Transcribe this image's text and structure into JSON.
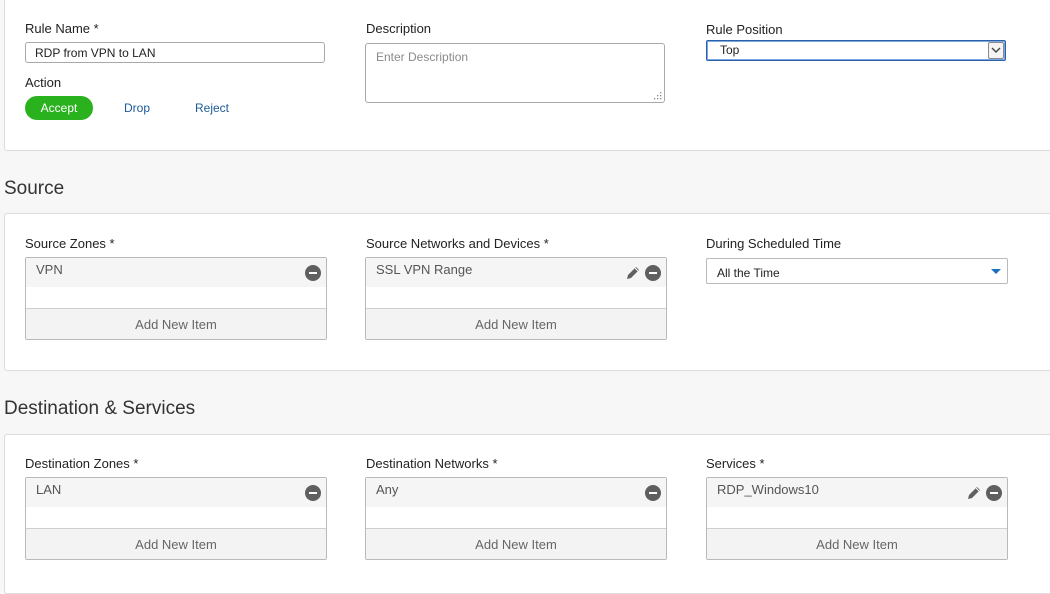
{
  "rule": {
    "name_label": "Rule Name *",
    "name_value": "RDP from VPN to LAN",
    "description_label": "Description",
    "description_placeholder": "Enter Description",
    "position_label": "Rule Position",
    "position_value": "Top",
    "action_label": "Action",
    "actions": [
      {
        "label": "Accept",
        "selected": true
      },
      {
        "label": "Drop",
        "selected": false
      },
      {
        "label": "Reject",
        "selected": false
      }
    ]
  },
  "source": {
    "title": "Source",
    "zones_label": "Source Zones *",
    "zones_items": [
      "VPN"
    ],
    "networks_label": "Source Networks and Devices *",
    "networks_items": [
      "SSL VPN Range"
    ],
    "schedule_label": "During Scheduled Time",
    "schedule_value": "All the Time"
  },
  "destination": {
    "title": "Destination & Services",
    "zones_label": "Destination Zones *",
    "zones_items": [
      "LAN"
    ],
    "networks_label": "Destination Networks *",
    "networks_items": [
      "Any"
    ],
    "services_label": "Services *",
    "services_items": [
      "RDP_Windows10"
    ]
  },
  "common": {
    "add_new_item": "Add New Item"
  },
  "colors": {
    "accent_green": "#29b21e",
    "link_blue": "#1d5a9a",
    "focus_blue": "#2b5fa8"
  },
  "icons": {
    "remove": "remove-icon",
    "edit": "pencil-edit-icon",
    "chevron": "chevron-down-icon",
    "dropdown_caret": "caret-down-icon"
  }
}
